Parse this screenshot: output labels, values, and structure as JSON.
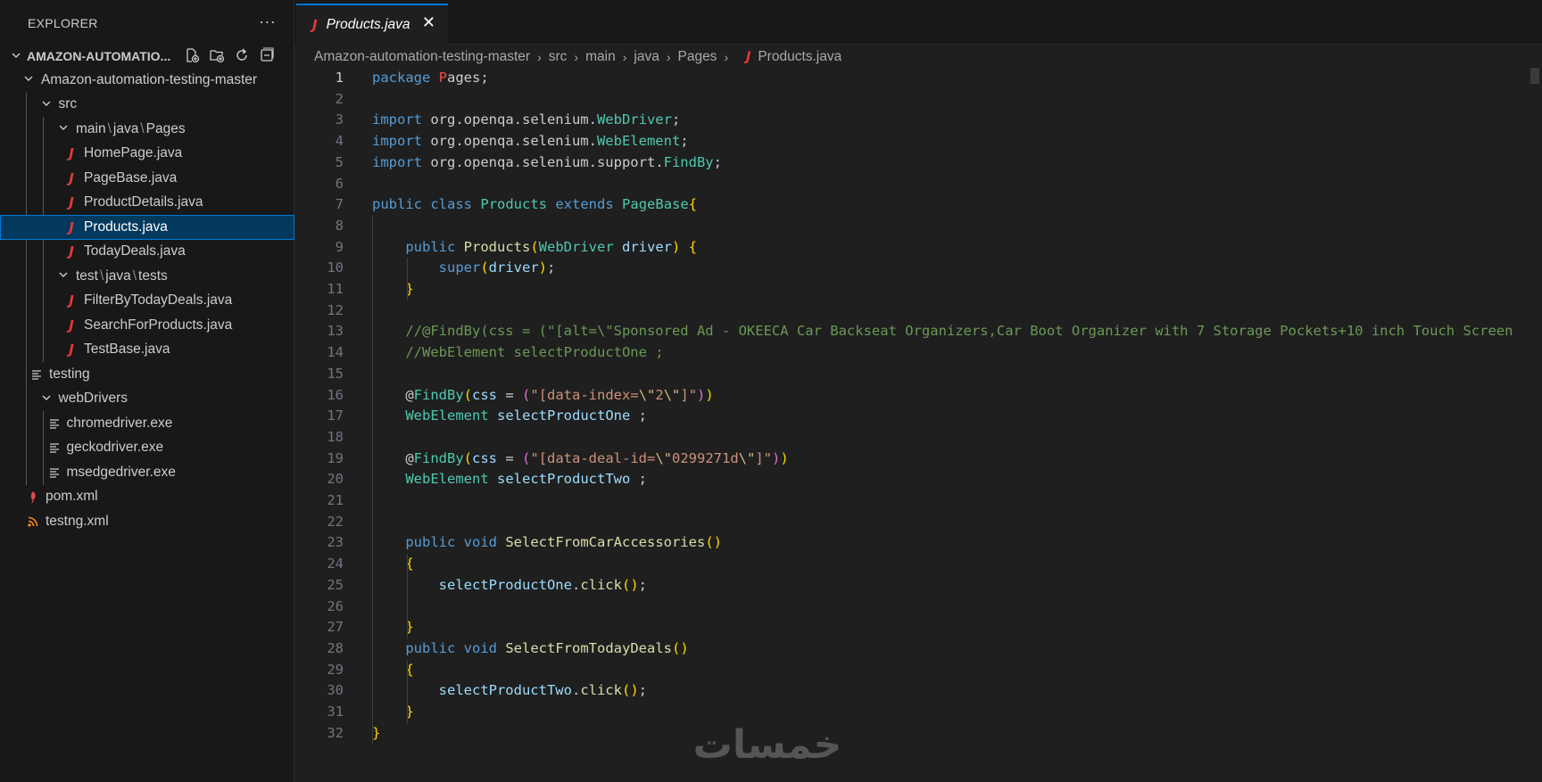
{
  "explorer": {
    "title": "EXPLORER",
    "more": "···",
    "root": "AMAZON-AUTOMATIO...",
    "tree": [
      {
        "label": "Amazon-automation-testing-master",
        "type": "folder"
      },
      {
        "label": "src",
        "type": "folder"
      },
      {
        "segments": [
          "main",
          "java",
          "Pages"
        ],
        "type": "folder"
      },
      {
        "label": "HomePage.java",
        "type": "java"
      },
      {
        "label": "PageBase.java",
        "type": "java"
      },
      {
        "label": "ProductDetails.java",
        "type": "java"
      },
      {
        "label": "Products.java",
        "type": "java",
        "selected": true
      },
      {
        "label": "TodayDeals.java",
        "type": "java"
      },
      {
        "segments": [
          "test",
          "java",
          "tests"
        ],
        "type": "folder"
      },
      {
        "label": "FilterByTodayDeals.java",
        "type": "java"
      },
      {
        "label": "SearchForProducts.java",
        "type": "java"
      },
      {
        "label": "TestBase.java",
        "type": "java"
      },
      {
        "label": "testing",
        "type": "text"
      },
      {
        "label": "webDrivers",
        "type": "folder"
      },
      {
        "label": "chromedriver.exe",
        "type": "text"
      },
      {
        "label": "geckodriver.exe",
        "type": "text"
      },
      {
        "label": "msedgedriver.exe",
        "type": "text"
      },
      {
        "label": "pom.xml",
        "type": "maven"
      },
      {
        "label": "testng.xml",
        "type": "rss"
      }
    ]
  },
  "tab": {
    "label": "Products.java",
    "icon": "J"
  },
  "breadcrumb": [
    "Amazon-automation-testing-master",
    "src",
    "main",
    "java",
    "Pages",
    "Products.java"
  ],
  "editor": {
    "active_line": 1,
    "lines": [
      "package Pages;",
      "",
      "import org.openqa.selenium.WebDriver;",
      "import org.openqa.selenium.WebElement;",
      "import org.openqa.selenium.support.FindBy;",
      "",
      "public class Products extends PageBase{",
      "",
      "    public Products(WebDriver driver) {",
      "        super(driver);",
      "    }",
      "",
      "    //@FindBy(css = (\"[alt=\\\"Sponsored Ad - OKEECA Car Backseat Organizers,Car Boot Organizer with 7 Storage Pockets+10 inch Touch Screen",
      "    //WebElement selectProductOne ;",
      "",
      "    @FindBy(css = (\"[data-index=\\\"2\\\"]\"))",
      "    WebElement selectProductOne ;",
      "",
      "    @FindBy(css = (\"[data-deal-id=\\\"0299271d\\\"]\"))",
      "    WebElement selectProductTwo ;",
      "",
      "",
      "    public void SelectFromCarAccessories()",
      "    {",
      "        selectProductOne.click();",
      "",
      "    }",
      "    public void SelectFromTodayDeals()",
      "    {",
      "        selectProductTwo.click();",
      "    }",
      "}"
    ]
  },
  "watermark": "خمسات"
}
